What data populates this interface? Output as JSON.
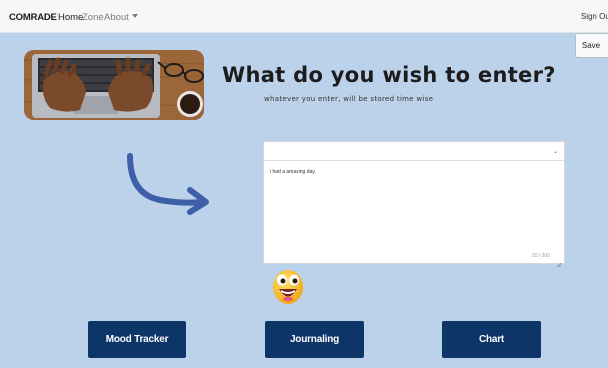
{
  "navbar": {
    "brand": "COMRADE",
    "links": [
      {
        "label": "Home"
      },
      {
        "label": "Zone"
      },
      {
        "label": "About"
      }
    ],
    "signout": "Sign Out"
  },
  "header": {
    "save_label": "Save",
    "title": "What do you wish to enter?",
    "subtitle": "whatever you enter, will be stored time wise"
  },
  "entry": {
    "text": "i had a amazing day.",
    "char_count": "20 / 200"
  },
  "icons": {
    "hero": "laptop-typing-image",
    "arrow": "curved-arrow-icon",
    "emoji": "grinning-face-icon"
  },
  "buttons": {
    "mood_tracker": "Mood Tracker",
    "journaling": "Journaling",
    "chart": "Chart"
  },
  "colors": {
    "background": "#bcd2ea",
    "button": "#0e3568",
    "arrow": "#3d5fa8"
  }
}
